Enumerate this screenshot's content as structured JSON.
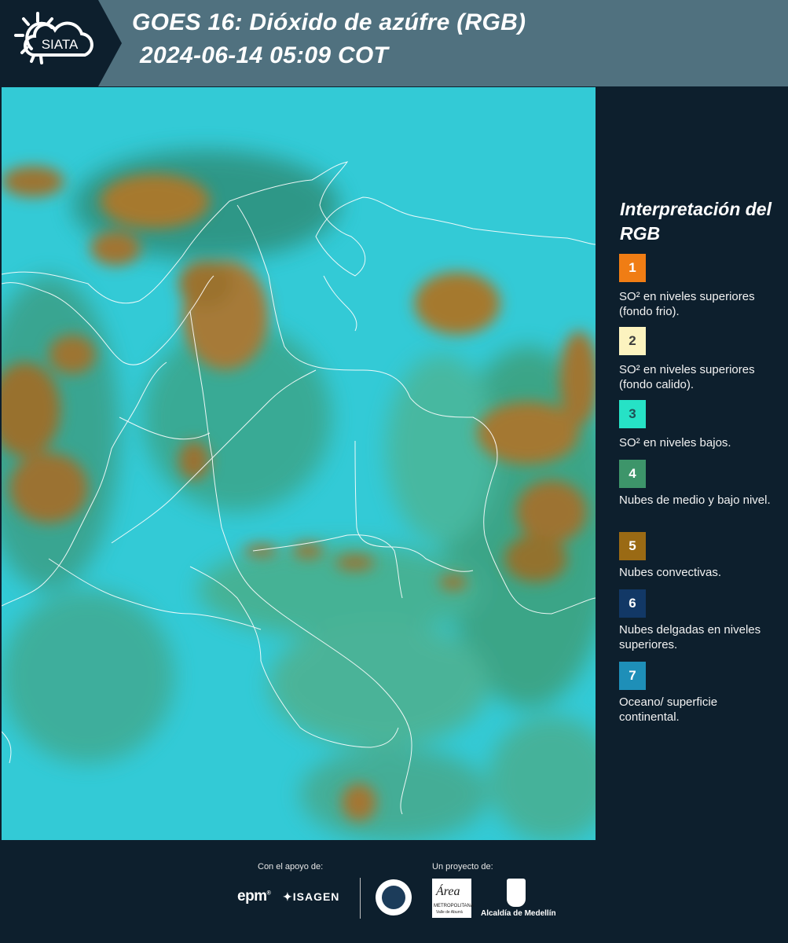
{
  "header": {
    "logo_text": "SIATA",
    "title_line1": "GOES 16: Dióxido de azúfre (RGB)",
    "title_line2": "2024-06-14 05:09 COT"
  },
  "legend": {
    "title": "Interpretación del RGB",
    "items": [
      {
        "number": "1",
        "color": "#f07d14",
        "text_color": "#ffffff",
        "label": "SO² en niveles superiores (fondo frio)."
      },
      {
        "number": "2",
        "color": "#fcf3bf",
        "text_color": "#3d3d3d",
        "label": "SO² en niveles superiores (fondo calido)."
      },
      {
        "number": "3",
        "color": "#26e2c6",
        "text_color": "#1f4f55",
        "label": "SO² en niveles bajos."
      },
      {
        "number": "4",
        "color": "#3d956a",
        "text_color": "#ffffff",
        "label": "Nubes de medio y bajo nivel."
      },
      {
        "number": "5",
        "color": "#9a6a14",
        "text_color": "#ffffff",
        "label": "Nubes convectivas."
      },
      {
        "number": "6",
        "color": "#123866",
        "text_color": "#ffffff",
        "label": "Nubes delgadas en niveles superiores."
      },
      {
        "number": "7",
        "color": "#1e8fb8",
        "text_color": "#ffffff",
        "label": "Oceano/ superficie continental."
      }
    ]
  },
  "footer": {
    "support_label": "Con el apoyo de:",
    "project_label": "Un proyecto de:",
    "sponsor1": "epm",
    "sponsor2": "ISAGEN",
    "partner_amva_name": "Área",
    "partner_amva_sub": "METROPOLITANA",
    "partner_amva_sub2": "Valle de Aburrá",
    "partner_alcaldia": "Alcaldía de Medellín"
  }
}
